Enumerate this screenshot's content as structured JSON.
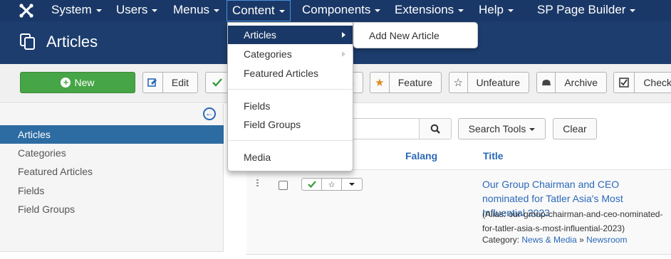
{
  "nav": {
    "items": [
      {
        "label": "System"
      },
      {
        "label": "Users"
      },
      {
        "label": "Menus"
      },
      {
        "label": "Content"
      },
      {
        "label": "Components"
      },
      {
        "label": "Extensions"
      },
      {
        "label": "Help"
      },
      {
        "label": "SP Page Builder"
      }
    ]
  },
  "header": {
    "title": "Articles"
  },
  "toolbar": {
    "new": "New",
    "edit": "Edit",
    "publish_partial": "h",
    "feature": "Feature",
    "unfeature": "Unfeature",
    "archive": "Archive",
    "checkin": "Check"
  },
  "sidebar": {
    "items": [
      {
        "label": "Articles"
      },
      {
        "label": "Categories"
      },
      {
        "label": "Featured Articles"
      },
      {
        "label": "Fields"
      },
      {
        "label": "Field Groups"
      }
    ]
  },
  "dropdown": {
    "items": [
      {
        "label": "Articles"
      },
      {
        "label": "Categories"
      },
      {
        "label": "Featured Articles"
      },
      {
        "label": "Fields"
      },
      {
        "label": "Field Groups"
      },
      {
        "label": "Media"
      }
    ],
    "submenu_item": "Add New Article"
  },
  "filters": {
    "search_tools": "Search Tools",
    "clear": "Clear"
  },
  "table": {
    "headers": {
      "falang": "Falang",
      "title": "Title"
    },
    "row": {
      "title": "Our Group Chairman and CEO nominated for Tatler Asia's Most Influential 2023",
      "alias": "(Alias: our-group-chairman-and-ceo-nominated-for-tatler-asia-s-most-influential-2023)",
      "category_label": "Category:",
      "category": "News & Media",
      "separator": "»",
      "subcategory": "Newsroom"
    }
  },
  "colors": {
    "topnav": "#1a3867",
    "header": "#1c3d6e",
    "new_button": "#46a546",
    "active_sidebar": "#2d6ca2",
    "link": "#2a69b8",
    "publish_check": "#3a9a3a",
    "feature_star": "#e08a1e"
  }
}
